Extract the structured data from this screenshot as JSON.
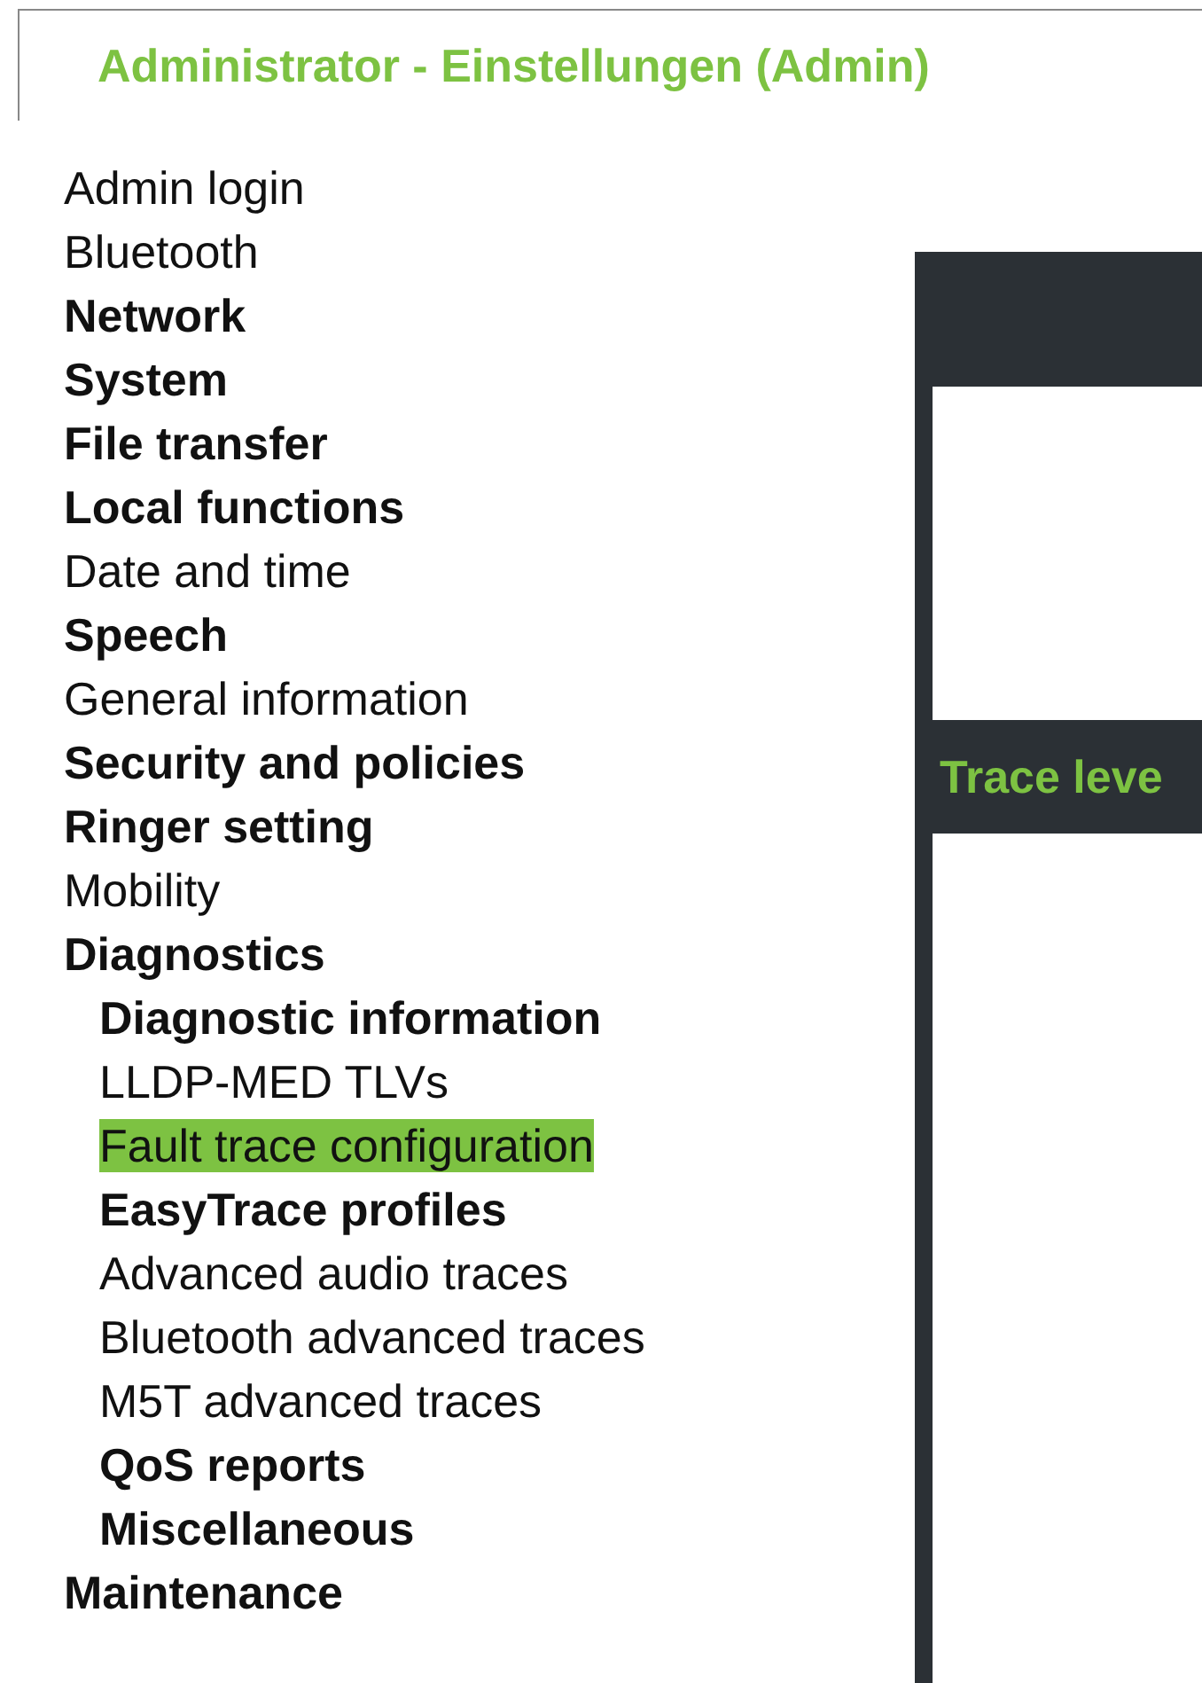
{
  "header": {
    "title": "Administrator - Einstellungen (Admin)"
  },
  "menu": [
    {
      "label": "Admin login",
      "bold": false,
      "selected": false
    },
    {
      "label": "Bluetooth",
      "bold": false,
      "selected": false
    },
    {
      "label": "Network",
      "bold": true,
      "selected": false
    },
    {
      "label": "System",
      "bold": true,
      "selected": false
    },
    {
      "label": "File transfer",
      "bold": true,
      "selected": false
    },
    {
      "label": "Local functions",
      "bold": true,
      "selected": false
    },
    {
      "label": "Date and time",
      "bold": false,
      "selected": false
    },
    {
      "label": "Speech",
      "bold": true,
      "selected": false
    },
    {
      "label": "General information",
      "bold": false,
      "selected": false
    },
    {
      "label": "Security and policies",
      "bold": true,
      "selected": false
    },
    {
      "label": "Ringer setting",
      "bold": true,
      "selected": false
    },
    {
      "label": "Mobility",
      "bold": false,
      "selected": false
    },
    {
      "label": "Diagnostics",
      "bold": true,
      "selected": false,
      "children": [
        {
          "label": "Diagnostic information",
          "bold": true,
          "selected": false
        },
        {
          "label": "LLDP-MED TLVs",
          "bold": false,
          "selected": false
        },
        {
          "label": "Fault trace configuration",
          "bold": false,
          "selected": true
        },
        {
          "label": "EasyTrace profiles",
          "bold": true,
          "selected": false
        },
        {
          "label": "Advanced audio traces",
          "bold": false,
          "selected": false
        },
        {
          "label": "Bluetooth advanced traces",
          "bold": false,
          "selected": false
        },
        {
          "label": "M5T advanced traces",
          "bold": false,
          "selected": false
        },
        {
          "label": "QoS reports",
          "bold": true,
          "selected": false
        },
        {
          "label": "Miscellaneous",
          "bold": true,
          "selected": false
        }
      ]
    },
    {
      "label": "Maintenance",
      "bold": true,
      "selected": false
    }
  ],
  "panel": {
    "section_heading": "Trace leve"
  }
}
